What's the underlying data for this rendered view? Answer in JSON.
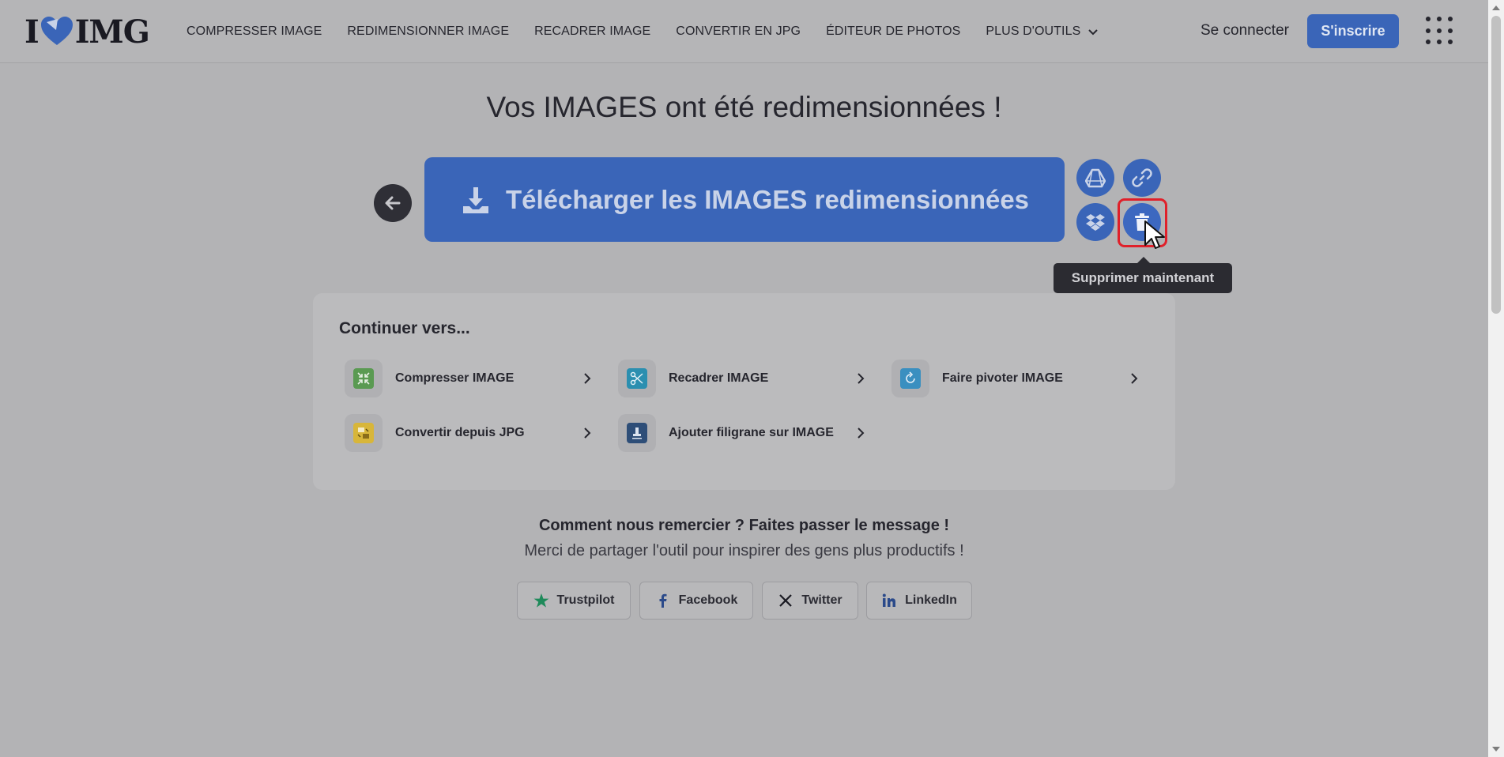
{
  "header": {
    "logo": {
      "left": "I",
      "right": "IMG"
    },
    "nav": [
      {
        "label": "COMPRESSER IMAGE"
      },
      {
        "label": "REDIMENSIONNER IMAGE"
      },
      {
        "label": "RECADRER IMAGE"
      },
      {
        "label": "CONVERTIR EN JPG"
      },
      {
        "label": "ÉDITEUR DE PHOTOS"
      },
      {
        "label": "PLUS D'OUTILS"
      }
    ],
    "login_label": "Se connecter",
    "signup_label": "S'inscrire"
  },
  "main": {
    "title": "Vos IMAGES ont été redimensionnées !",
    "download_label": "Télécharger les IMAGES redimensionnées",
    "tooltip": "Supprimer maintenant"
  },
  "continue": {
    "title": "Continuer vers...",
    "tools": [
      {
        "label": "Compresser IMAGE",
        "icon": "compress-icon",
        "color": "#5a9a52"
      },
      {
        "label": "Recadrer IMAGE",
        "icon": "crop-icon",
        "color": "#2b8fb0"
      },
      {
        "label": "Faire pivoter IMAGE",
        "icon": "rotate-icon",
        "color": "#3a8fc0"
      },
      {
        "label": "Convertir depuis JPG",
        "icon": "convert-icon",
        "color": "#d8b63a"
      },
      {
        "label": "Ajouter filigrane sur IMAGE",
        "icon": "watermark-icon",
        "color": "#2e4e78"
      }
    ]
  },
  "share": {
    "heading": "Comment nous remercier ? Faites passer le message !",
    "sub": "Merci de partager l'outil pour inspirer des gens plus productifs !",
    "buttons": [
      {
        "label": "Trustpilot",
        "icon": "trustpilot-star-icon"
      },
      {
        "label": "Facebook",
        "icon": "facebook-icon"
      },
      {
        "label": "Twitter",
        "icon": "x-icon"
      },
      {
        "label": "LinkedIn",
        "icon": "linkedin-icon"
      }
    ]
  },
  "colors": {
    "brand": "#3a65b8",
    "highlight": "#e0202a"
  }
}
